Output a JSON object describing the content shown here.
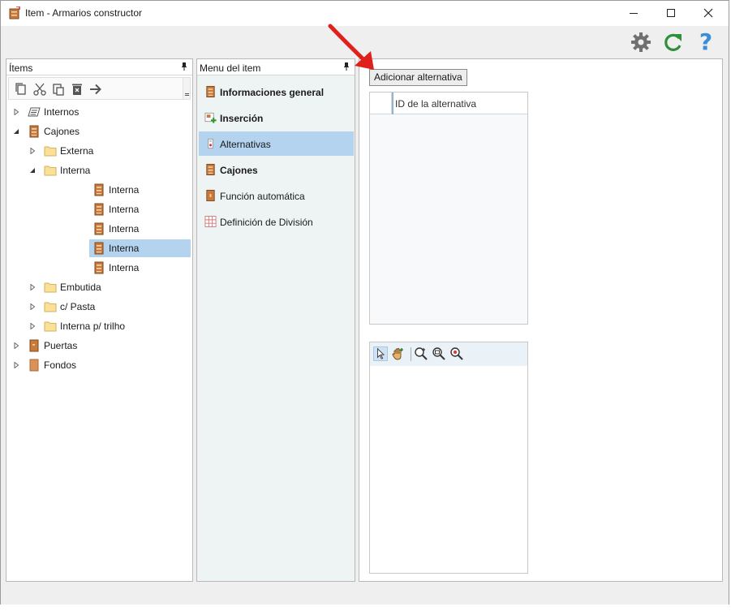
{
  "window": {
    "title": "Item - Armarios constructor"
  },
  "toolbar": {
    "icons": [
      "gear-icon",
      "refresh-icon",
      "help-icon"
    ],
    "help_glyph": "?"
  },
  "items_panel": {
    "header": "Ítems",
    "toolbar_icons": [
      "copy-icon",
      "cut-icon",
      "paste-icon",
      "delete-icon",
      "arrow-right-icon"
    ],
    "tree": [
      {
        "label": "Internos",
        "level": 0,
        "expanded": false,
        "icon": "list-icon"
      },
      {
        "label": "Cajones",
        "level": 0,
        "expanded": true,
        "icon": "drawer-icon"
      },
      {
        "label": "Externa",
        "level": 1,
        "expanded": false,
        "icon": "folder-icon"
      },
      {
        "label": "Interna",
        "level": 1,
        "expanded": true,
        "icon": "folder-icon"
      },
      {
        "label": "Interna",
        "level": 2,
        "icon": "drawer-icon"
      },
      {
        "label": "Interna",
        "level": 2,
        "icon": "drawer-icon"
      },
      {
        "label": "Interna",
        "level": 2,
        "icon": "drawer-icon"
      },
      {
        "label": "Interna",
        "level": 2,
        "icon": "drawer-icon",
        "selected": true
      },
      {
        "label": "Interna",
        "level": 2,
        "icon": "drawer-icon"
      },
      {
        "label": "Embutida",
        "level": 1,
        "expanded": false,
        "icon": "folder-icon"
      },
      {
        "label": "c/ Pasta",
        "level": 1,
        "expanded": false,
        "icon": "folder-icon"
      },
      {
        "label": "Interna p/ trilho",
        "level": 1,
        "expanded": false,
        "icon": "folder-icon"
      },
      {
        "label": "Puertas",
        "level": 0,
        "expanded": false,
        "icon": "door-icon"
      },
      {
        "label": "Fondos",
        "level": 0,
        "expanded": false,
        "icon": "panel-icon"
      }
    ]
  },
  "menu_panel": {
    "header": "Menu del item",
    "items": [
      {
        "label": "Informaciones general",
        "bold": true,
        "icon": "cabinet-icon"
      },
      {
        "label": "Inserción",
        "bold": true,
        "icon": "insert-icon"
      },
      {
        "label": "Alternativas",
        "bold": false,
        "icon": "alternatives-icon",
        "selected": true
      },
      {
        "label": "Cajones",
        "bold": true,
        "icon": "drawer-icon"
      },
      {
        "label": "Función automática",
        "bold": false,
        "icon": "auto-function-icon"
      },
      {
        "label": "Definición de División",
        "bold": false,
        "icon": "grid-icon"
      }
    ]
  },
  "alternatives": {
    "add_button": "Adicionar alternativa",
    "grid_column": "ID de la alternativa"
  },
  "viewer": {
    "toolbar_icons": [
      "pointer-icon",
      "pan-hand-icon",
      "zoom-in-icon",
      "zoom-window-icon",
      "zoom-extents-icon"
    ]
  },
  "colors": {
    "selection": "#b3d3ef",
    "annotation_arrow": "#e0201b",
    "help": "#3a8dd6",
    "refresh": "#2f8f3a",
    "gear": "#707070"
  }
}
